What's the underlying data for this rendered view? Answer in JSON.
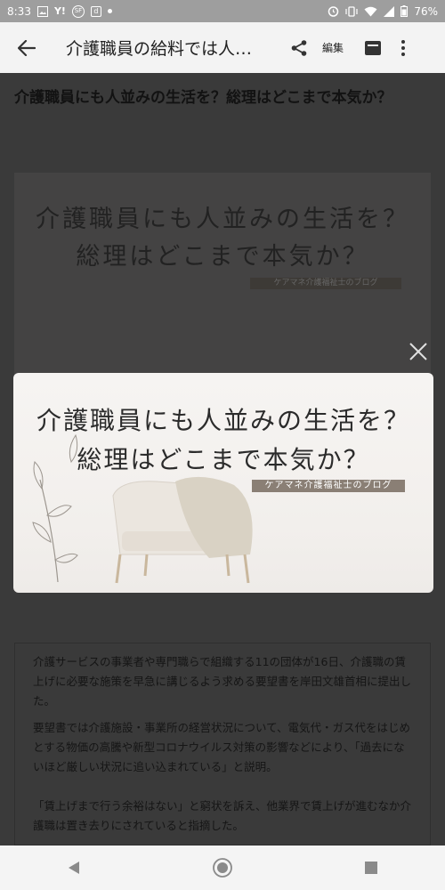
{
  "status_bar": {
    "time": "8:33",
    "left_icons": [
      "image-icon",
      "yahoo-icon",
      "sf-icon",
      "d-icon",
      "dot-icon"
    ],
    "yahoo_text": "Y!",
    "sf_text": "SF",
    "d_text": "d",
    "right_icons": [
      "alarm-icon",
      "vibrate-icon",
      "wifi-icon",
      "signal-icon",
      "battery-icon"
    ],
    "battery": "76%"
  },
  "toolbar": {
    "title": "介護職員の給料では人…",
    "edit_label": "編集"
  },
  "article": {
    "heading": "介護職員にも人並みの生活を？総理はどこまで本気か？",
    "hero_line1": "介護職員にも人並みの生活を？",
    "hero_line2": "総理はどこまで本気か？",
    "hero_tag": "ケアマネ介護福祉士のブログ",
    "paragraphs": [
      "介護サービスの事業者や専門職らで組織する11の団体が16日、介護職の賃上げに必要な施策を早急に講じるよう求める要望書を岸田文雄首相に提出した。",
      "要望書では介護施設・事業所の経営状況について、電気代・ガス代をはじめとする物価の高騰や新型コロナウイルス対策の影響などにより、「過去にないほど厳しい状況に追い込まれている」と説明。",
      "「賃上げまで行う余裕はない」と窮状を訴え、他業界で賃上げが進むなか介護職は置き去りにされていると指摘した。"
    ]
  },
  "lightbox": {
    "line1": "介護職員にも人並みの生活を？",
    "line2": "総理はどこまで本気か？",
    "tag": "ケアマネ介護福祉士のブログ"
  },
  "colors": {
    "overlay": "#333333",
    "toolbar_bg": "#f3f3f3",
    "status_bar_bg": "#9e9e9e",
    "tag_bg": "#8a7f75"
  }
}
